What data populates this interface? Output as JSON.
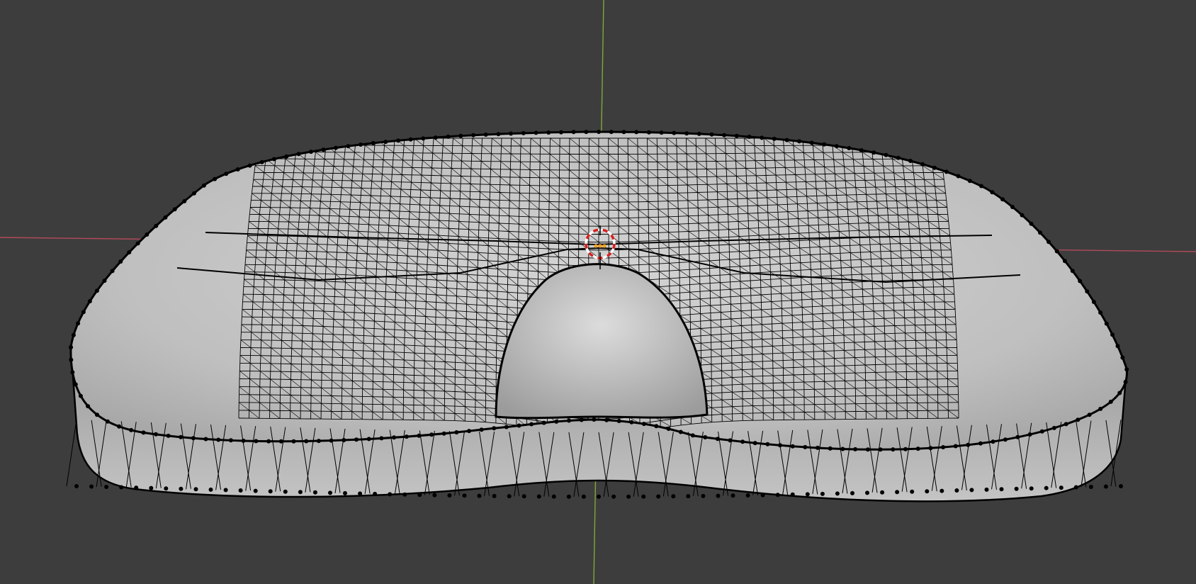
{
  "viewport": {
    "background_color": "#3d3d3d",
    "x_axis_color": "#b24a5a",
    "y_axis_color": "#7fa83a",
    "mesh_fill_color": "#c9c9c9",
    "mesh_shadow_color": "#8e8e8e",
    "wire_color": "#000000",
    "cursor_ring_colors": [
      "#d81e1e",
      "#ffffff"
    ],
    "object_origin_color": "#f0a020"
  },
  "mesh": {
    "shading": "solid",
    "overlay": "wireframe",
    "vertices_visible": true
  },
  "icons": [
    "3d-cursor-icon",
    "object-origin-icon"
  ]
}
